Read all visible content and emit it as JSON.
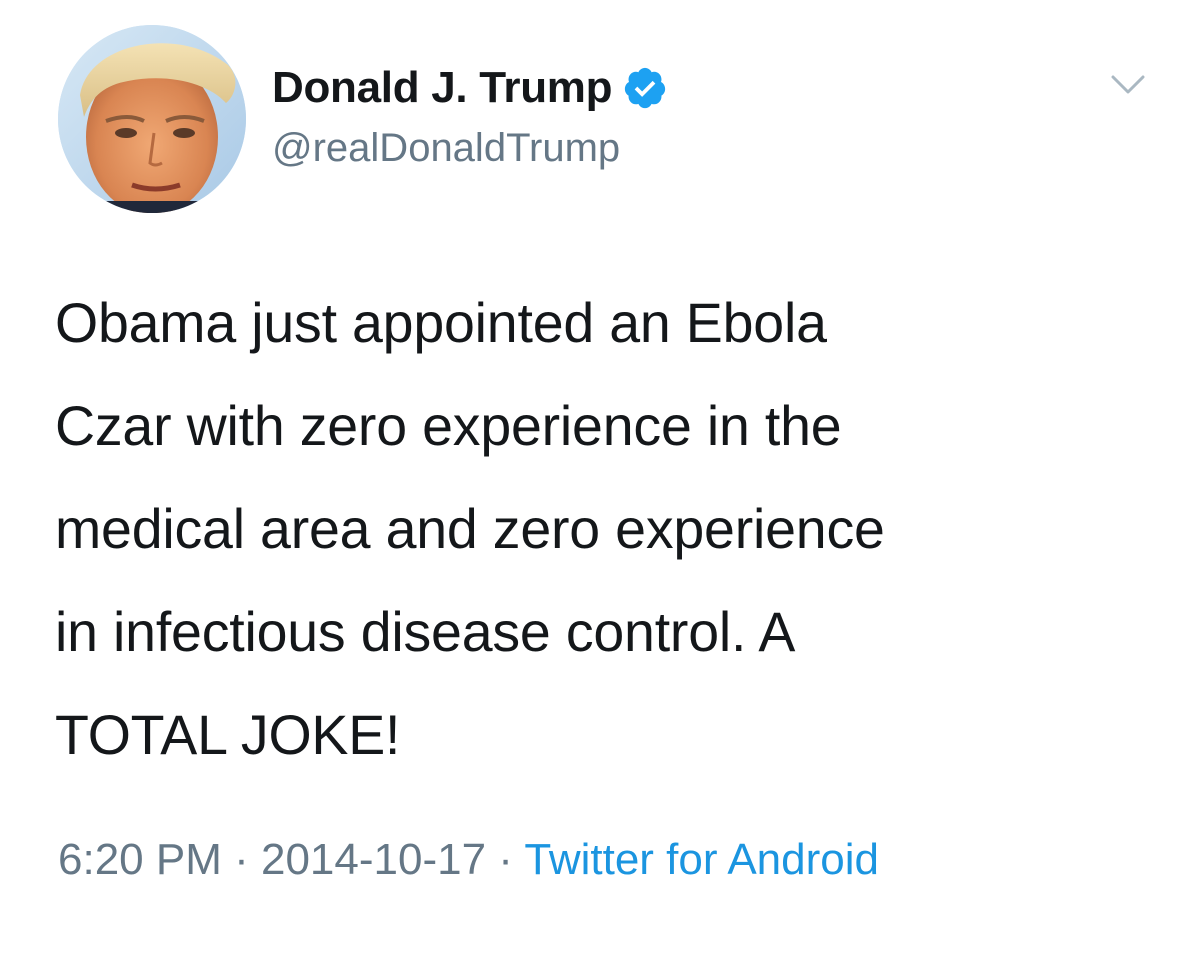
{
  "author": {
    "display_name": "Donald J. Trump",
    "handle": "@realDonaldTrump",
    "verified": true,
    "avatar_icon": "profile-photo"
  },
  "tweet": {
    "text": "Obama just appointed an Ebola\nCzar with zero experience in the\nmedical area and zero experience\nin infectious disease control. A\nTOTAL JOKE!"
  },
  "meta": {
    "time": "6:20 PM",
    "separator": " · ",
    "date": "2014-10-17",
    "source": "Twitter for Android"
  },
  "colors": {
    "text": "#14171a",
    "secondary": "#657786",
    "link": "#1b95e0",
    "verified_badge": "#1da1f2",
    "caret": "#aab8c2"
  }
}
